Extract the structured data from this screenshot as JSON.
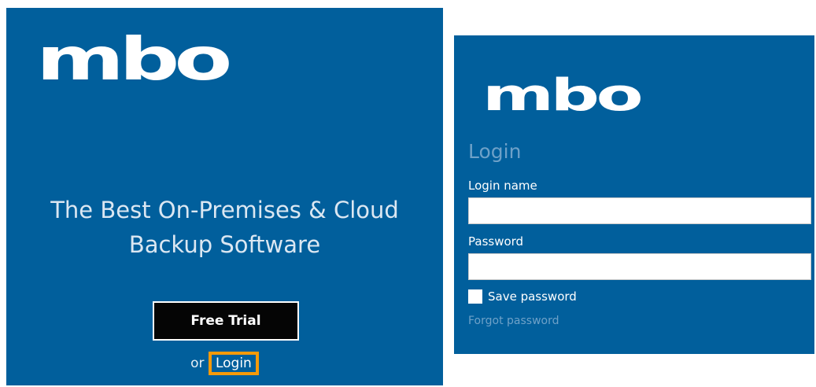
{
  "marketing_panel": {
    "logo": "mbo",
    "tagline_line1": "The Best On-Premises & Cloud",
    "tagline_line2": "Backup Software",
    "free_trial_label": "Free Trial",
    "or_text": "or",
    "login_link_label": "Login",
    "highlight_color": "#f59a0a"
  },
  "login_panel": {
    "logo": "mbo",
    "heading": "Login",
    "login_name_label": "Login name",
    "login_name_value": "",
    "password_label": "Password",
    "password_value": "",
    "save_password_label": "Save password",
    "save_password_checked": false,
    "forgot_password_label": "Forgot password"
  },
  "colors": {
    "brand_blue": "#015f9c",
    "button_black": "#050505",
    "muted_link": "#6ea1c8"
  }
}
